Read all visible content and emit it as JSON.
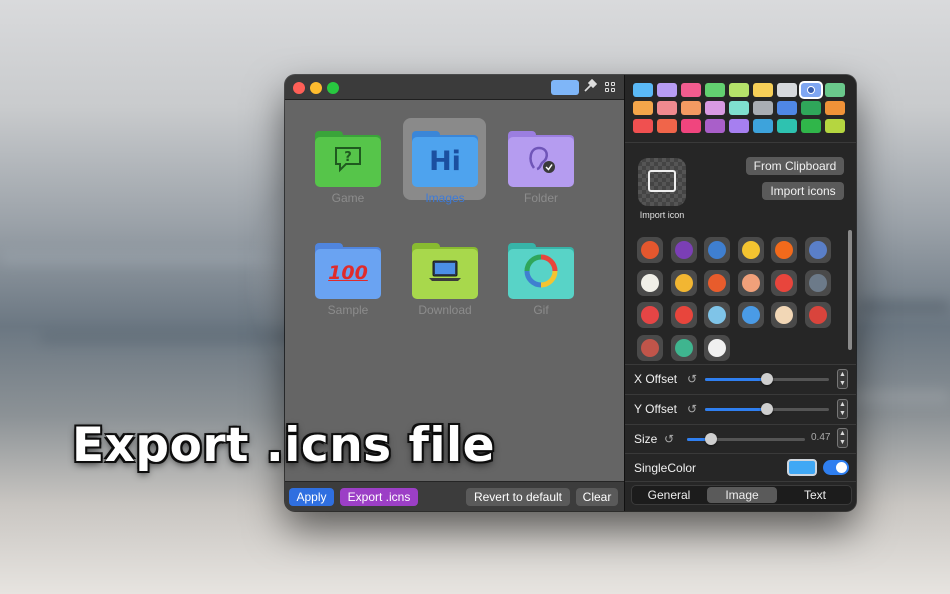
{
  "headline": "Export .icns file",
  "colors": {
    "accent": "#2f7ff0",
    "apply_button": "#2f6fe0",
    "export_button": "#9c3fc6",
    "single_color": "#40a8f5"
  },
  "titlebar": {
    "traffic_lights": [
      "#fe5f57",
      "#febc2e",
      "#28c840"
    ],
    "icons": [
      "color-swatch-icon",
      "eyedropper-icon",
      "grid-icon"
    ]
  },
  "folders": [
    {
      "label": "Game",
      "color": "#56c54a",
      "tab": "#3aa43a",
      "glyph": "question-bubble-icon",
      "selected": false
    },
    {
      "label": "Images",
      "color": "#4ea3ee",
      "tab": "#3a86d8",
      "glyph_text": "Hi",
      "selected": true
    },
    {
      "label": "Folder",
      "color": "#b59cf0",
      "tab": "#9b7ee0",
      "glyph": "ear-icon",
      "selected": false
    },
    {
      "label": "Sample",
      "color": "#6aa3f2",
      "tab": "#5085de",
      "glyph_text": "100",
      "selected": false
    },
    {
      "label": "Download",
      "color": "#a8d84c",
      "tab": "#88bb30",
      "glyph": "laptop-icon",
      "selected": false
    },
    {
      "label": "Gif",
      "color": "#58d3c7",
      "tab": "#37b4a8",
      "glyph": "refresh-cycle-icon",
      "selected": false
    }
  ],
  "bottom_buttons": {
    "apply": "Apply",
    "export": "Export .icns",
    "revert": "Revert to default",
    "clear": "Clear"
  },
  "palette": [
    [
      "#5ab8f5",
      "#b79cf3",
      "#f25c8f",
      "#62d070",
      "#b5e26a",
      "#f7cf58",
      "#d6d8dc",
      "#7fa6f2",
      "#6ac98c"
    ],
    [
      "#f4a64a",
      "#f08a8f",
      "#f39a62",
      "#d89ae2",
      "#7fe0cf",
      "#a9adb3",
      "#4f87e6",
      "#2fa65a",
      "#f09238"
    ],
    [
      "#f05050",
      "#f0654a",
      "#f0457e",
      "#a95fc9",
      "#a67ff0",
      "#3da3dc",
      "#2ec2b0",
      "#30b64a",
      "#b5d640"
    ]
  ],
  "palette_selected_index": 7,
  "import": {
    "tile_label": "Import icon",
    "from_clipboard": "From Clipboard",
    "import_icons": "Import icons"
  },
  "emoji_icons": [
    [
      "compass-icon",
      "bootstrap-icon",
      "monitor-icon",
      "padlock-icon",
      "infinity-icon",
      "magic-wand-icon"
    ],
    [
      "map-icon",
      "medal-icon",
      "sync-circle-icon",
      "piggy-bank-icon",
      "lifebuoy-icon",
      "floppy-disk-icon"
    ],
    [
      "gift-icon",
      "clown-icon",
      "chemistry-flask-icon",
      "bus-icon",
      "person-icon",
      "first-aid-icon"
    ],
    [
      "backpack-icon",
      "beach-ball-icon",
      "yin-yang-icon"
    ]
  ],
  "emoji_colors": [
    [
      "#e4572e",
      "#7b3fb5",
      "#3f7fd0",
      "#f4c430",
      "#f26a1b",
      "#5a7fc8"
    ],
    [
      "#f0efe8",
      "#f2b632",
      "#e85c2c",
      "#f0a07a",
      "#e8453c",
      "#6c7a89"
    ],
    [
      "#e64545",
      "#e8453c",
      "#7fc4e8",
      "#4a9be6",
      "#f2d7b6",
      "#d9443c"
    ],
    [
      "#c0554a",
      "#3fb58f",
      "#f0f0f0"
    ]
  ],
  "controls": {
    "x_offset": {
      "label": "X Offset",
      "value": 0.5
    },
    "y_offset": {
      "label": "Y Offset",
      "value": 0.5
    },
    "size": {
      "label": "Size",
      "value": 0.47,
      "value_text": "0.47"
    },
    "single_color": {
      "label": "SingleColor",
      "enabled": true
    }
  },
  "tabs": [
    {
      "label": "General",
      "selected": false
    },
    {
      "label": "Image",
      "selected": true
    },
    {
      "label": "Text",
      "selected": false
    }
  ]
}
